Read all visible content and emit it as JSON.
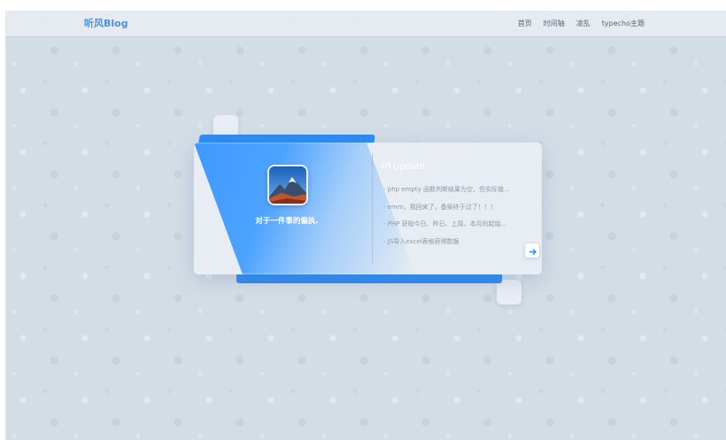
{
  "nav": {
    "brand": "听风Blog",
    "links": [
      "首页",
      "时间轴",
      "凌乱",
      "typecho主题"
    ]
  },
  "profile": {
    "motto": "对于一件事的偏执."
  },
  "update": {
    "title": "Update",
    "items": [
      "- php empty 函数判断结果为空，但实际值...",
      "- emm，我回来了，备案终于过了！！！",
      "- PHP 获取今日、昨日、上周、本月的起始...",
      "- JS导入excel表格获得数据"
    ]
  },
  "icons": {
    "code": "code-icon",
    "arrow": "arrow-right-icon"
  },
  "colors": {
    "accent": "#2f8cf4",
    "brand": "#4f8fd8",
    "background": "#d3dde6"
  }
}
